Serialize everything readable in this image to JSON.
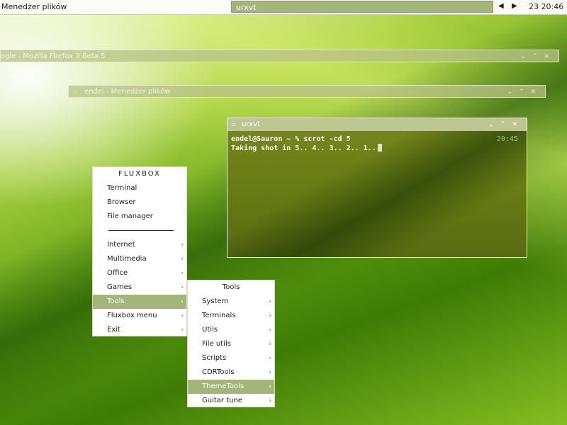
{
  "taskbar": {
    "app_name": "Menedżer plików",
    "active_task": "urxvt",
    "prev_label": "◀",
    "next_label": "▶",
    "clock": "23 20:46"
  },
  "windows": {
    "firefox": {
      "title": "ogle - Mozilla Firefox 3 Beta 5",
      "buttons": "⌄⌃✕"
    },
    "file_manager": {
      "title": "endel - Menedżer plików",
      "buttons": "⌄⌃✕"
    }
  },
  "terminal": {
    "title": "urxvt",
    "buttons": "⌄⌃✕",
    "prompt": "endel@Sauron ~ % scrot -cd 5",
    "output": "Taking shot in 5.. 4.. 3.. 2.. 1..",
    "time": "20:45"
  },
  "root_menu": {
    "title": "FLUXBOX",
    "items": [
      "Terminal",
      "Browser",
      "File manager",
      "Internet",
      "Multimedia",
      "Office",
      "Games",
      "Tools",
      "Fluxbox menu",
      "Exit"
    ]
  },
  "tools_menu": {
    "title": "Tools",
    "items": [
      "System",
      "Terminals",
      "Utils",
      "File utils",
      "Scripts",
      "CDRTools",
      "ThemeTools",
      "Guitar tune"
    ]
  },
  "colors": {
    "accent": "#a4b57c",
    "menu_bg": "#ffffff",
    "terminal_bg": "#687a14"
  },
  "icons": {
    "submenu": "chevron-right-icon",
    "window_menu": "window-menu-icon",
    "minimize": "minimize-icon",
    "maximize": "maximize-icon",
    "close": "close-icon"
  }
}
